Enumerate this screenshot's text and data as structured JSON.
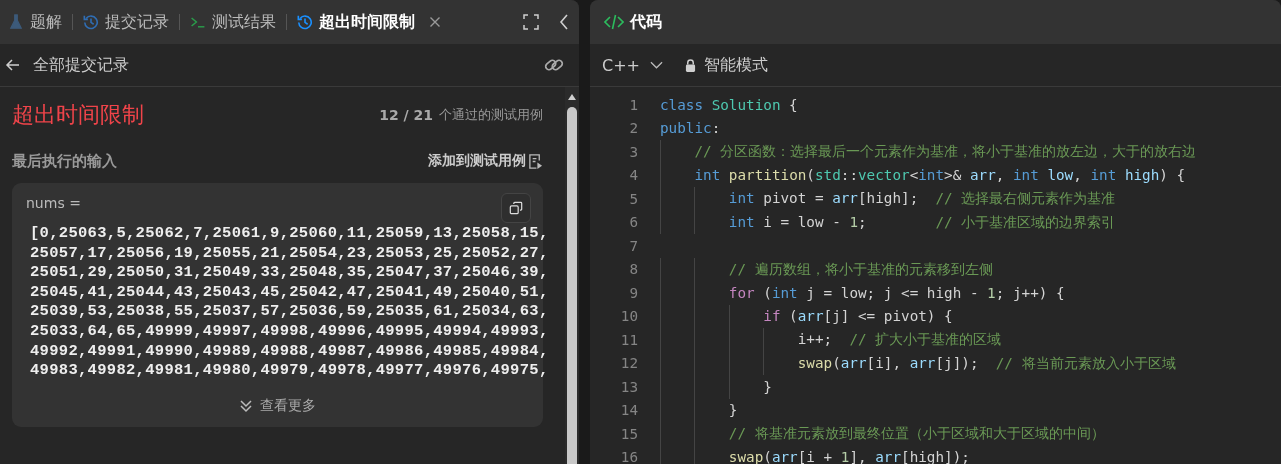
{
  "left_panel": {
    "tabs": [
      {
        "label": "题解",
        "kind": "flask",
        "selected": false,
        "closable": false
      },
      {
        "label": "提交记录",
        "kind": "history",
        "selected": false,
        "closable": false
      },
      {
        "label": "测试结果",
        "kind": "terminal",
        "selected": false,
        "closable": false
      },
      {
        "label": "超出时间限制",
        "kind": "history",
        "selected": true,
        "closable": true
      }
    ],
    "back_label": "全部提交记录",
    "result": {
      "status": "超出时间限制",
      "passed": "12 / 21",
      "passed_label": "个通过的测试用例"
    },
    "last_input": {
      "heading": "最后执行的输入",
      "add_button": "添加到测试用例",
      "variable": "nums =",
      "lines": [
        "[0,25063,5,25062,7,25061,9,25060,11,25059,13,25058,15,",
        "25057,17,25056,19,25055,21,25054,23,25053,25,25052,27,",
        "25051,29,25050,31,25049,33,25048,35,25047,37,25046,39,",
        "25045,41,25044,43,25043,45,25042,47,25041,49,25040,51,",
        "25039,53,25038,55,25037,57,25036,59,25035,61,25034,63,",
        "25033,64,65,49999,49997,49998,49996,49995,49994,49993,",
        "49992,49991,49990,49989,49988,49987,49986,49985,49984,",
        "49983,49982,49981,49980,49979,49978,49977,49976,49975,"
      ],
      "more": "查看更多"
    }
  },
  "code_panel": {
    "title": "代码",
    "language": "C++",
    "mode": "智能模式",
    "lines": [
      {
        "number": "1",
        "tokens": [
          {
            "kind": "keyword",
            "text": "class"
          },
          {
            "kind": "type",
            "text": " Solution"
          },
          {
            "kind": "plain",
            "text": " {"
          }
        ]
      },
      {
        "number": "2",
        "tokens": [
          {
            "kind": "keyword",
            "text": "public"
          },
          {
            "kind": "plain",
            "text": ":"
          }
        ]
      },
      {
        "number": "3",
        "tokens": [
          {
            "kind": "comment",
            "text": "    // 分区函数：选择最后一个元素作为基准，将小于基准的放左边，大于的放右边"
          }
        ]
      },
      {
        "number": "4",
        "tokens": [
          {
            "kind": "keyword",
            "text": "    int"
          },
          {
            "kind": "func",
            "text": " partition"
          },
          {
            "kind": "plain",
            "text": "("
          },
          {
            "kind": "type",
            "text": "std"
          },
          {
            "kind": "plain",
            "text": "::"
          },
          {
            "kind": "type",
            "text": "vector"
          },
          {
            "kind": "plain",
            "text": "<"
          },
          {
            "kind": "keyword",
            "text": "int"
          },
          {
            "kind": "plain",
            "text": ">& "
          },
          {
            "kind": "var",
            "text": "arr"
          },
          {
            "kind": "plain",
            "text": ", "
          },
          {
            "kind": "keyword",
            "text": "int"
          },
          {
            "kind": "var",
            "text": " low"
          },
          {
            "kind": "plain",
            "text": ", "
          },
          {
            "kind": "keyword",
            "text": "int"
          },
          {
            "kind": "var",
            "text": " high"
          },
          {
            "kind": "plain",
            "text": ") {"
          }
        ]
      },
      {
        "number": "5",
        "tokens": [
          {
            "kind": "keyword",
            "text": "        int"
          },
          {
            "kind": "plain",
            "text": " pivot = "
          },
          {
            "kind": "var",
            "text": "arr"
          },
          {
            "kind": "plain",
            "text": "[high];  "
          },
          {
            "kind": "comment",
            "text": "// 选择最右侧元素作为基准"
          }
        ]
      },
      {
        "number": "6",
        "tokens": [
          {
            "kind": "keyword",
            "text": "        int"
          },
          {
            "kind": "plain",
            "text": " i = low - "
          },
          {
            "kind": "number",
            "text": "1"
          },
          {
            "kind": "plain",
            "text": ";        "
          },
          {
            "kind": "comment",
            "text": "// 小于基准区域的边界索引"
          }
        ]
      },
      {
        "number": "7"
      },
      {
        "number": "8",
        "tokens": [
          {
            "kind": "comment",
            "text": "        // 遍历数组，将小于基准的元素移到左侧"
          }
        ]
      },
      {
        "number": "9",
        "tokens": [
          {
            "kind": "control",
            "text": "        for"
          },
          {
            "kind": "plain",
            "text": " ("
          },
          {
            "kind": "keyword",
            "text": "int"
          },
          {
            "kind": "plain",
            "text": " j = low; j <= high - "
          },
          {
            "kind": "number",
            "text": "1"
          },
          {
            "kind": "plain",
            "text": "; j++) {"
          }
        ]
      },
      {
        "number": "10",
        "tokens": [
          {
            "kind": "control",
            "text": "            if"
          },
          {
            "kind": "plain",
            "text": " ("
          },
          {
            "kind": "var",
            "text": "arr"
          },
          {
            "kind": "plain",
            "text": "[j] <= pivot) {"
          }
        ]
      },
      {
        "number": "11",
        "tokens": [
          {
            "kind": "plain",
            "text": "                i++;  "
          },
          {
            "kind": "comment",
            "text": "// 扩大小于基准的区域"
          }
        ]
      },
      {
        "number": "12",
        "tokens": [
          {
            "kind": "func",
            "text": "                swap"
          },
          {
            "kind": "plain",
            "text": "("
          },
          {
            "kind": "var",
            "text": "arr"
          },
          {
            "kind": "plain",
            "text": "[i], "
          },
          {
            "kind": "var",
            "text": "arr"
          },
          {
            "kind": "plain",
            "text": "[j]);  "
          },
          {
            "kind": "comment",
            "text": "// 将当前元素放入小于区域"
          }
        ]
      },
      {
        "number": "13",
        "tokens": [
          {
            "kind": "plain",
            "text": "            }"
          }
        ]
      },
      {
        "number": "14",
        "tokens": [
          {
            "kind": "plain",
            "text": "        }"
          }
        ]
      },
      {
        "number": "15",
        "tokens": [
          {
            "kind": "comment",
            "text": "        // 将基准元素放到最终位置（小于区域和大于区域的中间）"
          }
        ]
      },
      {
        "number": "16",
        "tokens": [
          {
            "kind": "func",
            "text": "        swap"
          },
          {
            "kind": "plain",
            "text": "("
          },
          {
            "kind": "var",
            "text": "arr"
          },
          {
            "kind": "plain",
            "text": "[i + "
          },
          {
            "kind": "number",
            "text": "1"
          },
          {
            "kind": "plain",
            "text": "], "
          },
          {
            "kind": "var",
            "text": "arr"
          },
          {
            "kind": "plain",
            "text": "[high]);"
          }
        ]
      }
    ]
  }
}
